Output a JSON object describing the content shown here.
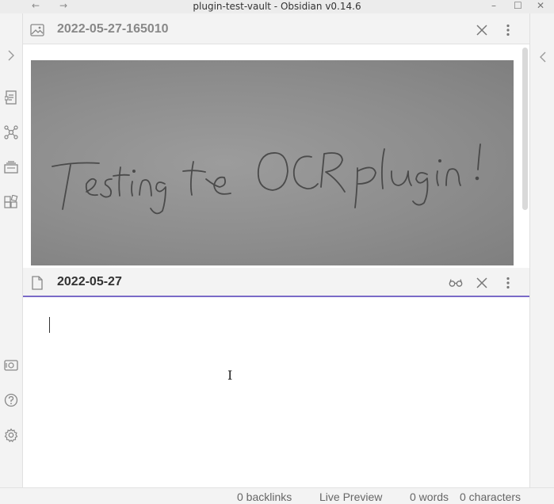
{
  "window": {
    "title": "plugin-test-vault - Obsidian v0.14.6",
    "back_icon": "←",
    "forward_icon": "→",
    "minimize_icon": "–",
    "maximize_icon": "☐",
    "close_icon": "✕"
  },
  "ribbon": {
    "items": [
      "expand-sidebar-icon",
      "open-quick-switcher-icon",
      "graph-view-icon",
      "slides-icon",
      "plugins-icon",
      "vault-icon",
      "help-icon",
      "settings-icon"
    ]
  },
  "panes": {
    "image_pane": {
      "title": "2022-05-27-165010",
      "handwritten_text": "Testing the OCR plugin!"
    },
    "note_pane": {
      "title": "2022-05-27"
    }
  },
  "status": {
    "backlinks": "0 backlinks",
    "mode": "Live Preview",
    "words": "0 words",
    "characters": "0 characters"
  },
  "colors": {
    "accent": "#7a6ac7",
    "background": "#f3f3f3"
  }
}
